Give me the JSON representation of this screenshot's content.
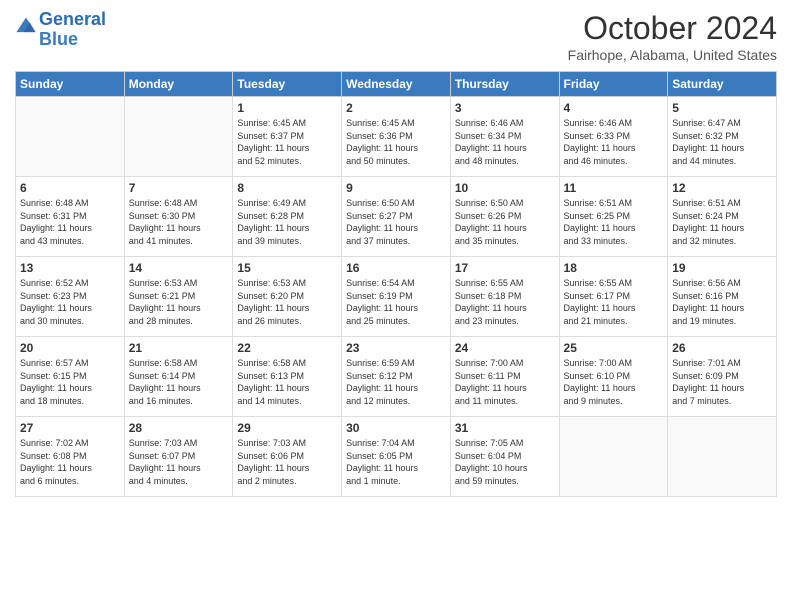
{
  "header": {
    "logo_line1": "General",
    "logo_line2": "Blue",
    "month_title": "October 2024",
    "location": "Fairhope, Alabama, United States"
  },
  "days_of_week": [
    "Sunday",
    "Monday",
    "Tuesday",
    "Wednesday",
    "Thursday",
    "Friday",
    "Saturday"
  ],
  "weeks": [
    [
      {
        "num": "",
        "info": ""
      },
      {
        "num": "",
        "info": ""
      },
      {
        "num": "1",
        "info": "Sunrise: 6:45 AM\nSunset: 6:37 PM\nDaylight: 11 hours\nand 52 minutes."
      },
      {
        "num": "2",
        "info": "Sunrise: 6:45 AM\nSunset: 6:36 PM\nDaylight: 11 hours\nand 50 minutes."
      },
      {
        "num": "3",
        "info": "Sunrise: 6:46 AM\nSunset: 6:34 PM\nDaylight: 11 hours\nand 48 minutes."
      },
      {
        "num": "4",
        "info": "Sunrise: 6:46 AM\nSunset: 6:33 PM\nDaylight: 11 hours\nand 46 minutes."
      },
      {
        "num": "5",
        "info": "Sunrise: 6:47 AM\nSunset: 6:32 PM\nDaylight: 11 hours\nand 44 minutes."
      }
    ],
    [
      {
        "num": "6",
        "info": "Sunrise: 6:48 AM\nSunset: 6:31 PM\nDaylight: 11 hours\nand 43 minutes."
      },
      {
        "num": "7",
        "info": "Sunrise: 6:48 AM\nSunset: 6:30 PM\nDaylight: 11 hours\nand 41 minutes."
      },
      {
        "num": "8",
        "info": "Sunrise: 6:49 AM\nSunset: 6:28 PM\nDaylight: 11 hours\nand 39 minutes."
      },
      {
        "num": "9",
        "info": "Sunrise: 6:50 AM\nSunset: 6:27 PM\nDaylight: 11 hours\nand 37 minutes."
      },
      {
        "num": "10",
        "info": "Sunrise: 6:50 AM\nSunset: 6:26 PM\nDaylight: 11 hours\nand 35 minutes."
      },
      {
        "num": "11",
        "info": "Sunrise: 6:51 AM\nSunset: 6:25 PM\nDaylight: 11 hours\nand 33 minutes."
      },
      {
        "num": "12",
        "info": "Sunrise: 6:51 AM\nSunset: 6:24 PM\nDaylight: 11 hours\nand 32 minutes."
      }
    ],
    [
      {
        "num": "13",
        "info": "Sunrise: 6:52 AM\nSunset: 6:23 PM\nDaylight: 11 hours\nand 30 minutes."
      },
      {
        "num": "14",
        "info": "Sunrise: 6:53 AM\nSunset: 6:21 PM\nDaylight: 11 hours\nand 28 minutes."
      },
      {
        "num": "15",
        "info": "Sunrise: 6:53 AM\nSunset: 6:20 PM\nDaylight: 11 hours\nand 26 minutes."
      },
      {
        "num": "16",
        "info": "Sunrise: 6:54 AM\nSunset: 6:19 PM\nDaylight: 11 hours\nand 25 minutes."
      },
      {
        "num": "17",
        "info": "Sunrise: 6:55 AM\nSunset: 6:18 PM\nDaylight: 11 hours\nand 23 minutes."
      },
      {
        "num": "18",
        "info": "Sunrise: 6:55 AM\nSunset: 6:17 PM\nDaylight: 11 hours\nand 21 minutes."
      },
      {
        "num": "19",
        "info": "Sunrise: 6:56 AM\nSunset: 6:16 PM\nDaylight: 11 hours\nand 19 minutes."
      }
    ],
    [
      {
        "num": "20",
        "info": "Sunrise: 6:57 AM\nSunset: 6:15 PM\nDaylight: 11 hours\nand 18 minutes."
      },
      {
        "num": "21",
        "info": "Sunrise: 6:58 AM\nSunset: 6:14 PM\nDaylight: 11 hours\nand 16 minutes."
      },
      {
        "num": "22",
        "info": "Sunrise: 6:58 AM\nSunset: 6:13 PM\nDaylight: 11 hours\nand 14 minutes."
      },
      {
        "num": "23",
        "info": "Sunrise: 6:59 AM\nSunset: 6:12 PM\nDaylight: 11 hours\nand 12 minutes."
      },
      {
        "num": "24",
        "info": "Sunrise: 7:00 AM\nSunset: 6:11 PM\nDaylight: 11 hours\nand 11 minutes."
      },
      {
        "num": "25",
        "info": "Sunrise: 7:00 AM\nSunset: 6:10 PM\nDaylight: 11 hours\nand 9 minutes."
      },
      {
        "num": "26",
        "info": "Sunrise: 7:01 AM\nSunset: 6:09 PM\nDaylight: 11 hours\nand 7 minutes."
      }
    ],
    [
      {
        "num": "27",
        "info": "Sunrise: 7:02 AM\nSunset: 6:08 PM\nDaylight: 11 hours\nand 6 minutes."
      },
      {
        "num": "28",
        "info": "Sunrise: 7:03 AM\nSunset: 6:07 PM\nDaylight: 11 hours\nand 4 minutes."
      },
      {
        "num": "29",
        "info": "Sunrise: 7:03 AM\nSunset: 6:06 PM\nDaylight: 11 hours\nand 2 minutes."
      },
      {
        "num": "30",
        "info": "Sunrise: 7:04 AM\nSunset: 6:05 PM\nDaylight: 11 hours\nand 1 minute."
      },
      {
        "num": "31",
        "info": "Sunrise: 7:05 AM\nSunset: 6:04 PM\nDaylight: 10 hours\nand 59 minutes."
      },
      {
        "num": "",
        "info": ""
      },
      {
        "num": "",
        "info": ""
      }
    ]
  ]
}
